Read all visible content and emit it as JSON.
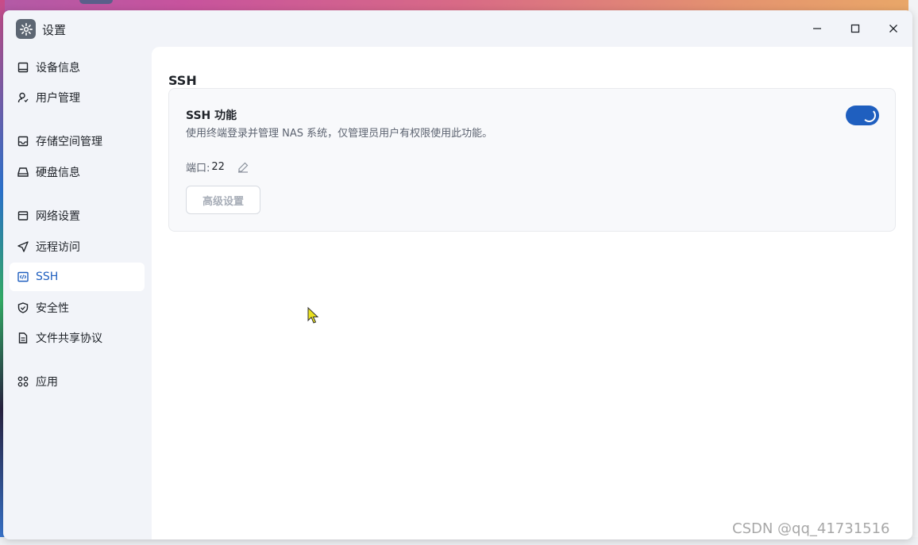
{
  "window": {
    "title": "设置",
    "controls": [
      "minimize-icon",
      "maximize-icon",
      "close-icon"
    ]
  },
  "sidebar": {
    "items": [
      {
        "label": "设备信息",
        "icon": "monitor-icon"
      },
      {
        "label": "用户管理",
        "icon": "user-icon"
      },
      {
        "label": "存储空间管理",
        "icon": "storage-icon"
      },
      {
        "label": "硬盘信息",
        "icon": "disk-icon"
      },
      {
        "label": "网络设置",
        "icon": "network-icon"
      },
      {
        "label": "远程访问",
        "icon": "send-icon"
      },
      {
        "label": "SSH",
        "icon": "code-icon",
        "active": true
      },
      {
        "label": "安全性",
        "icon": "shield-icon"
      },
      {
        "label": "文件共享协议",
        "icon": "file-icon"
      },
      {
        "label": "应用",
        "icon": "apps-icon"
      }
    ]
  },
  "main": {
    "title": "SSH",
    "card": {
      "title": "SSH 功能",
      "description": "使用终端登录并管理 NAS 系统，仅管理员用户有权限使用此功能。",
      "toggle_on": true,
      "port_label": "端口:",
      "port_value": "22",
      "advanced_button": "高级设置"
    }
  },
  "watermark": "CSDN @qq_41731516",
  "colors": {
    "accent": "#1f5fbf",
    "sidebar_bg": "#f2f4f9",
    "content_bg": "#ffffff"
  }
}
